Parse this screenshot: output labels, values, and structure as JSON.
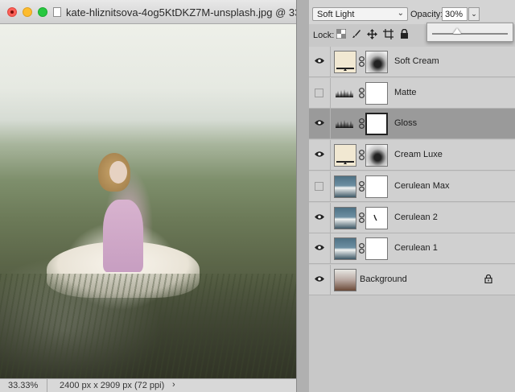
{
  "document": {
    "title": "kate-hliznitsova-4og5KtDKZ7M-unsplash.jpg @ 33....",
    "zoom": "33.33%",
    "doc_size": "2400 px x 2909 px (72 ppi)",
    "status_arrow": "›"
  },
  "options": {
    "blend_mode": "Soft Light",
    "opacity_label": "Opacity:",
    "opacity_value": "30%",
    "opacity_fraction": 0.3
  },
  "lock": {
    "label": "Lock:"
  },
  "layers": [
    {
      "name": "Soft Cream",
      "visible": true,
      "type": "fill",
      "mask": "bw"
    },
    {
      "name": "Matte",
      "visible": false,
      "type": "adjustment",
      "mask": "white"
    },
    {
      "name": "Gloss",
      "visible": true,
      "type": "adjustment",
      "mask": "white",
      "selected": true
    },
    {
      "name": "Cream Luxe",
      "visible": true,
      "type": "fill",
      "mask": "bw"
    },
    {
      "name": "Cerulean Max",
      "visible": false,
      "type": "cerulean",
      "mask": "white"
    },
    {
      "name": "Cerulean 2",
      "visible": true,
      "type": "cerulean",
      "mask": "stroke"
    },
    {
      "name": "Cerulean 1",
      "visible": true,
      "type": "cerulean",
      "mask": "white"
    },
    {
      "name": "Background",
      "visible": true,
      "type": "photo",
      "locked": true
    }
  ],
  "icons": {
    "eye": "eye-icon",
    "link": "chain-link-icon",
    "lock": "padlock-icon"
  }
}
